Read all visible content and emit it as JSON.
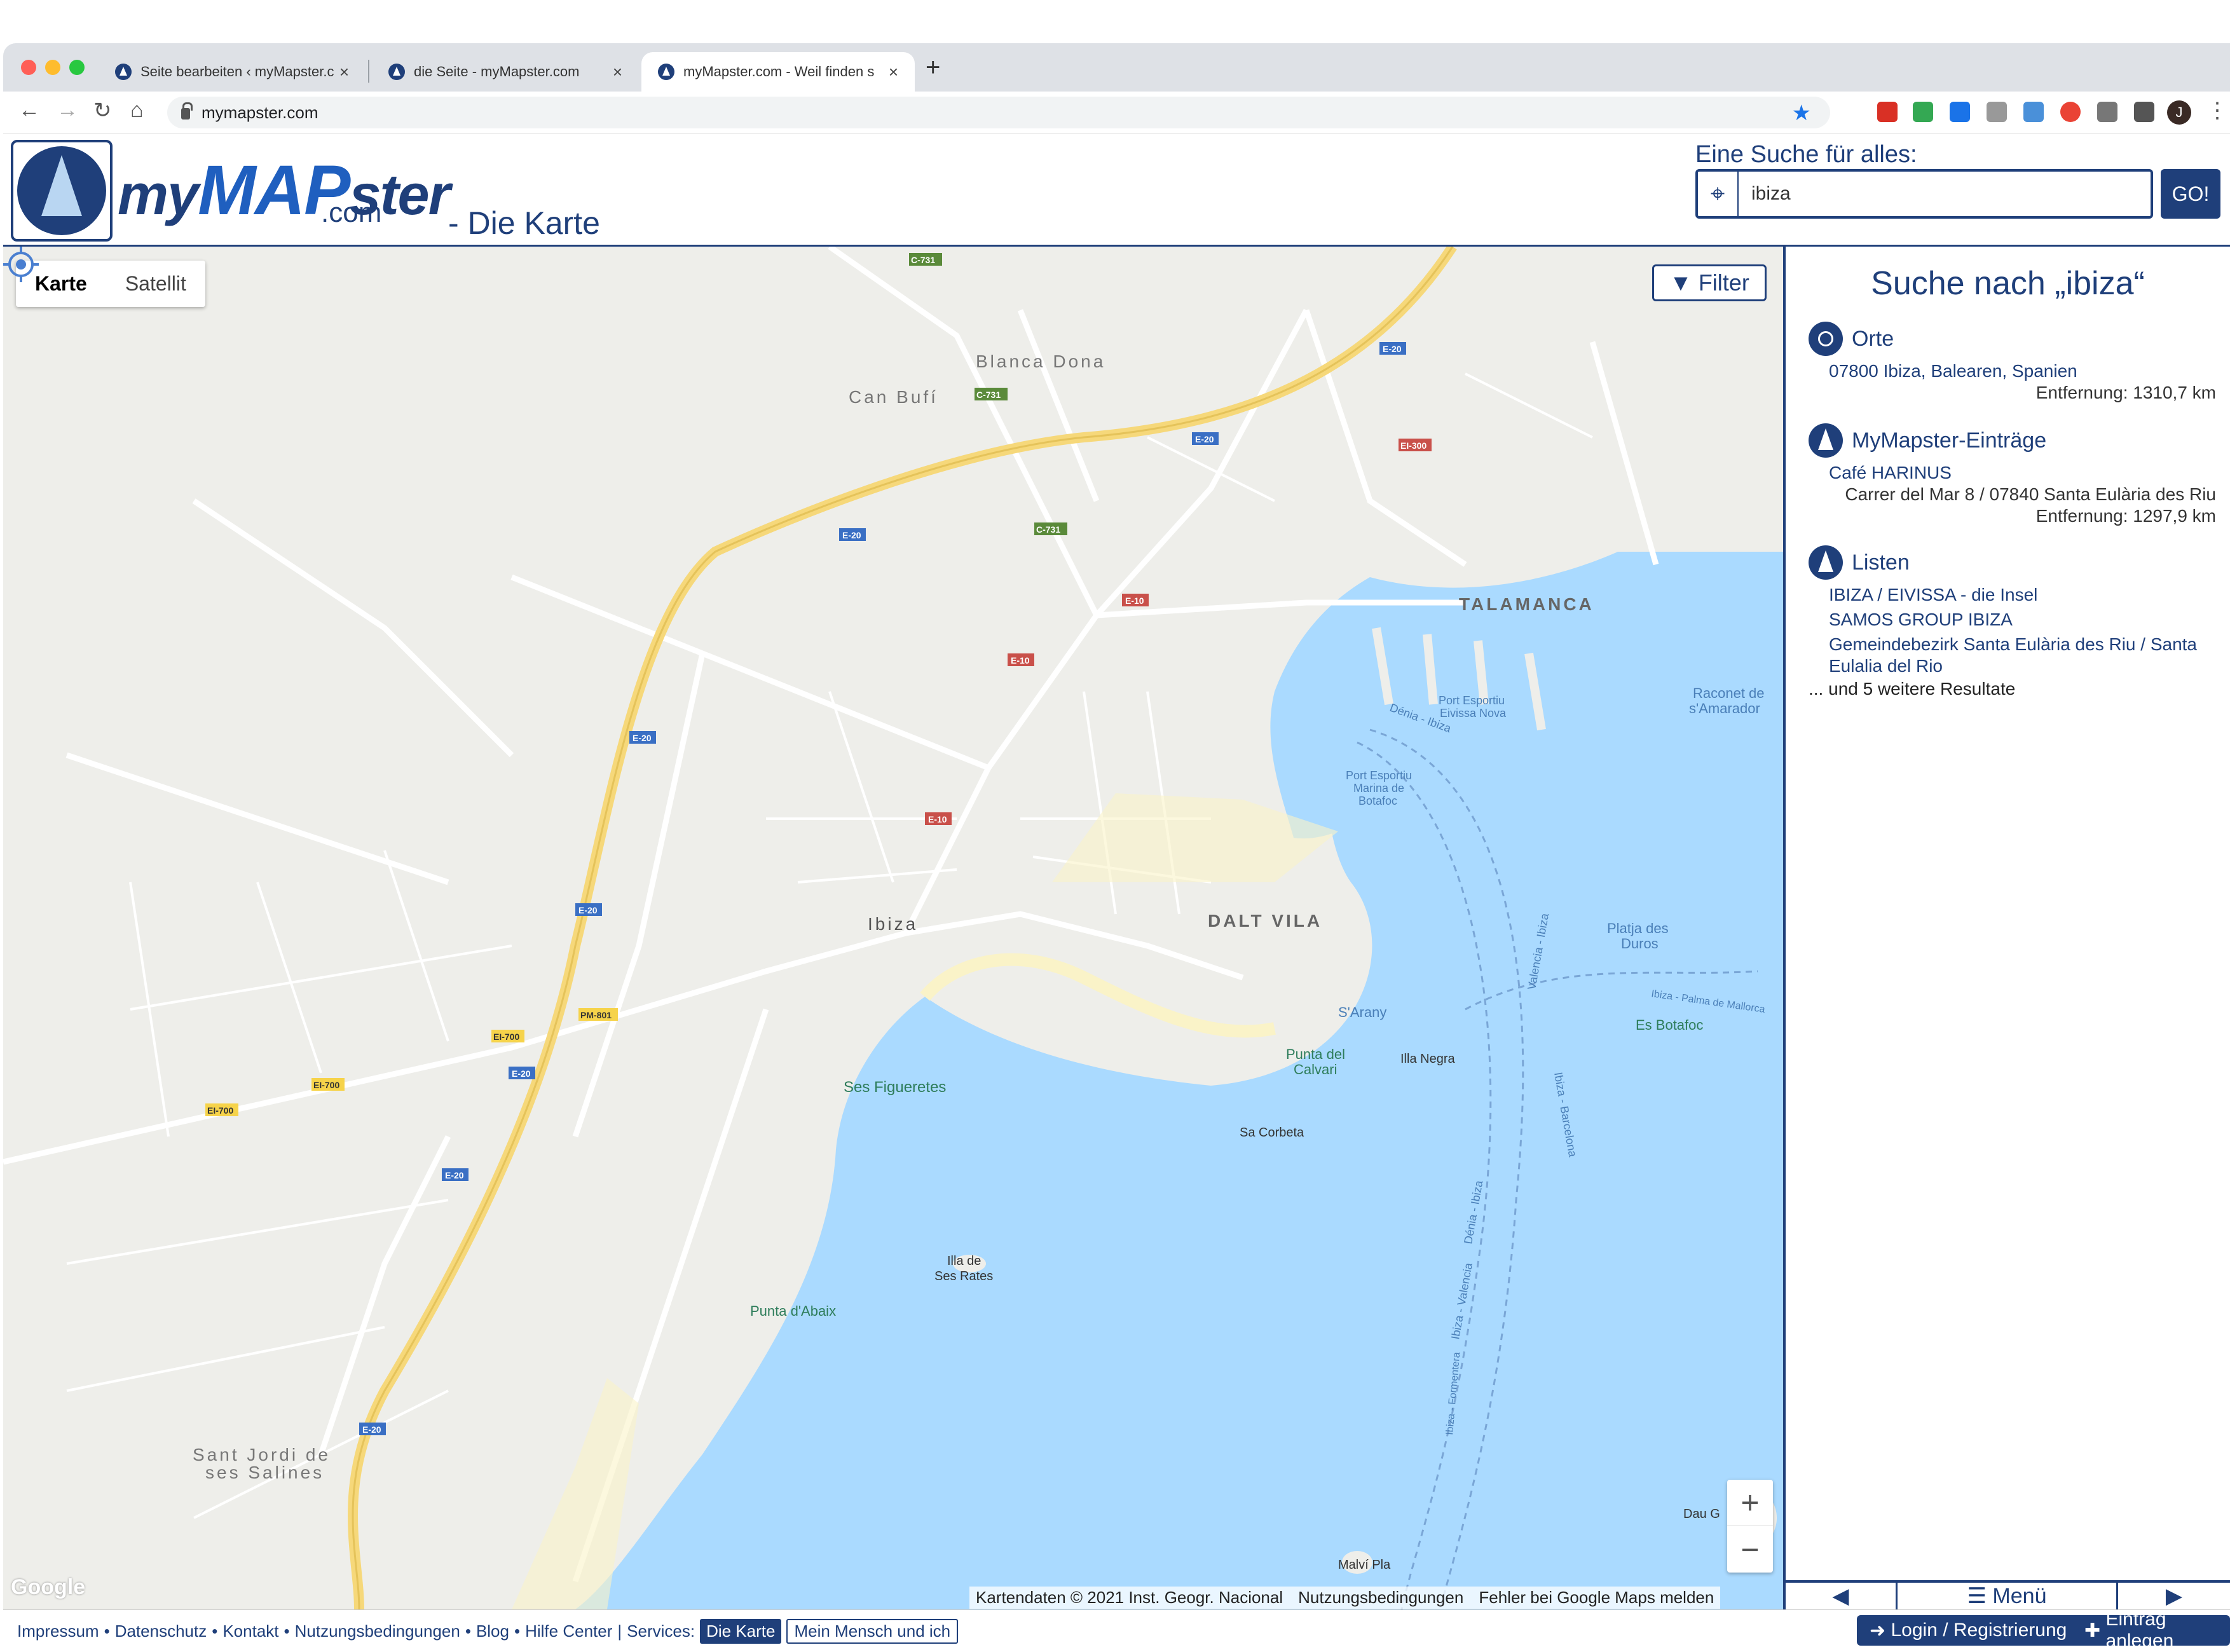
{
  "browser": {
    "tabs": [
      {
        "title": "Seite bearbeiten ‹ myMapster.c"
      },
      {
        "title": "die Seite - myMapster.com"
      },
      {
        "title": "myMapster.com - Weil finden s"
      }
    ],
    "url": "mymapster.com",
    "avatar_initial": "J"
  },
  "header": {
    "logo_my": "my",
    "logo_map": "MAP",
    "logo_ster": "ster",
    "logo_com": ".com",
    "subtitle": "- Die Karte",
    "search_label": "Eine Suche für alles:",
    "search_value": "ibiza",
    "go_label": "GO!"
  },
  "map": {
    "types": [
      "Karte",
      "Satellit"
    ],
    "active_type": "Karte",
    "filter_label": "Filter",
    "zoom_in": "+",
    "zoom_out": "−",
    "attribution": [
      "Kartendaten © 2021 Inst. Geogr. Nacional",
      "Nutzungsbedingungen",
      "Fehler bei Google Maps melden"
    ],
    "google_logo": "Google",
    "labels": {
      "blanca_dona": "Blanca Dona",
      "can_bufi": "Can Bufí",
      "talamanca": "TALAMANCA",
      "dalt_vila": "DALT VILA",
      "ibiza": "Ibiza",
      "ses_figueretes": "Ses Figueretes",
      "punta_calvari_1": "Punta del",
      "punta_calvari_2": "Calvari",
      "illa_negra": "Illa Negra",
      "sa_corbeta": "Sa Corbeta",
      "sarany": "S'Arany",
      "illa_rates_1": "Illa de",
      "illa_rates_2": "Ses Rates",
      "punta_abaix": "Punta d'Abaix",
      "sant_jordi_1": "Sant Jordi de",
      "sant_jordi_2": "ses Salines",
      "platja_duros_1": "Platja des",
      "platja_duros_2": "Duros",
      "es_botafoc": "Es Botafoc",
      "raconet_1": "Raconet de",
      "raconet_2": "s'Amarador",
      "port_nova_1": "Port Esportiu",
      "port_nova_2": "Eivissa Nova",
      "port_botafoc_1": "Port Esportiu",
      "port_botafoc_2": "Marina de",
      "port_botafoc_3": "Botafoc",
      "dau_gran": "Dau G",
      "malvi_pla": "Malví Pla",
      "ferry_denia": "Dénia - Ibiza",
      "ferry_valencia": "Valencia - Ibiza",
      "ferry_barcelona": "Ibiza - Barcelona",
      "ferry_palma": "Ibiza - Palma de Mallorca",
      "ferry_denia2": "Dénia - Ibiza",
      "ferry_valencia2": "Ibiza - Valencia",
      "ferry_formentera": "Ibiza - Formentera",
      "road_e20": "E-20",
      "road_e10": "E-10",
      "road_c731": "C-731",
      "road_ei700": "EI-700",
      "road_pm801": "PM-801",
      "road_ei300": "EI-300"
    }
  },
  "sidebar": {
    "title": "Suche nach „ibiza“",
    "orte_label": "Orte",
    "orte_link": "07800 Ibiza, Balearen, Spanien",
    "orte_distance": "Entfernung: 1310,7 km",
    "entries_label": "MyMapster-Einträge",
    "entry_link": "Café HARINUS",
    "entry_address": "Carrer del Mar 8 / 07840 Santa Eulària des Riu",
    "entry_distance": "Entfernung: 1297,9 km",
    "lists_label": "Listen",
    "list_1": "IBIZA / EIVISSA - die Insel",
    "list_2": "SAMOS GROUP IBIZA",
    "list_3a": "Gemeindebezirk Santa Eulària des Riu / Santa",
    "list_3b": "Eulalia del Rio",
    "more_results": "... und 5 weitere Resultate",
    "nav_prev": "◀",
    "nav_menu": "☰ Menü",
    "nav_next": "▶"
  },
  "footer": {
    "links": [
      "Impressum",
      "Datenschutz",
      "Kontakt",
      "Nutzungsbedingungen",
      "Blog",
      "Hilfe Center"
    ],
    "services_label": "Services:",
    "service_active": "Die Karte",
    "service_other": "Mein Mensch und ich",
    "login_label": "Login / Registrierung",
    "entry_label": "Eintrag anlegen"
  },
  "colors": {
    "brand": "#1f3f7a",
    "water": "#aadaff",
    "land": "#eeeeea",
    "highway": "#f8dc78"
  }
}
